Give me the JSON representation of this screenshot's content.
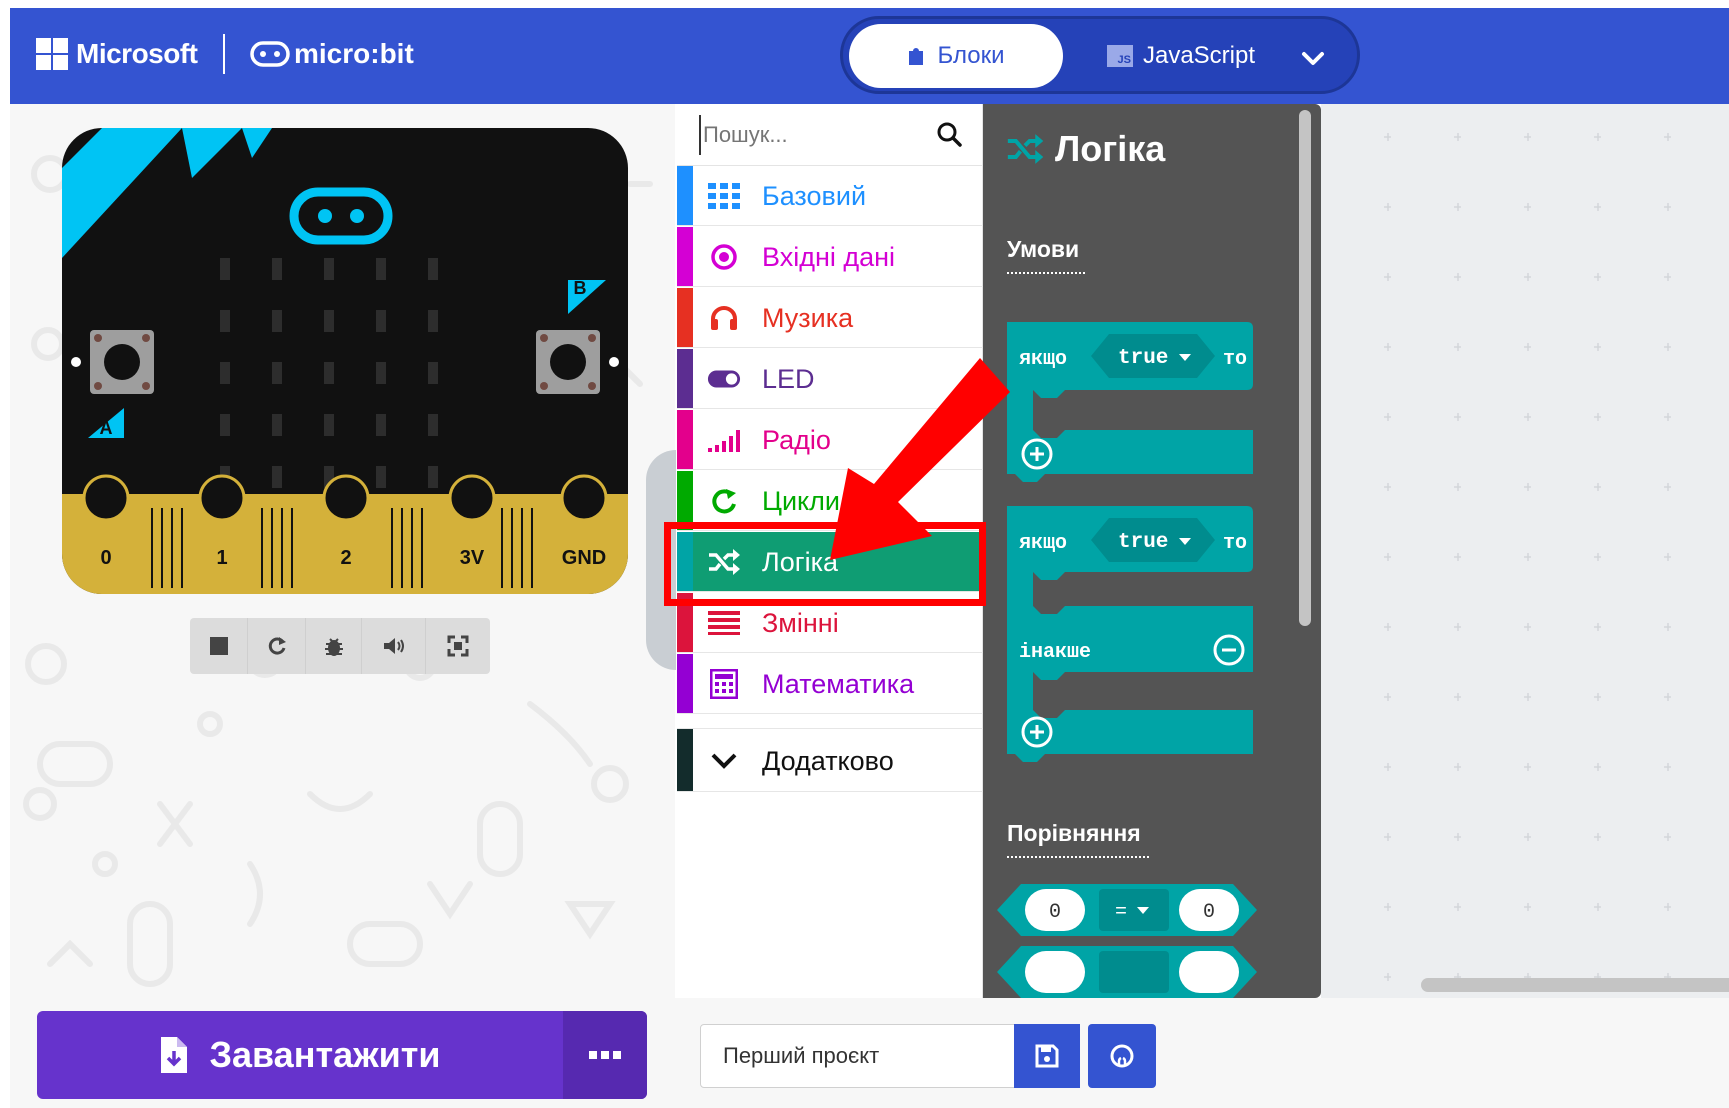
{
  "header": {
    "brand": "Microsoft",
    "product": "micro:bit",
    "tabs": {
      "blocks": "Блоки",
      "javascript": "JavaScript",
      "js_badge": "JS"
    },
    "colors": {
      "bar": "#3454d1"
    }
  },
  "simulator": {
    "pins": [
      "0",
      "1",
      "2",
      "3V",
      "GND"
    ],
    "button_a": "A",
    "button_b": "B",
    "controls": [
      "stop-icon",
      "restart-icon",
      "debug-icon",
      "sound-icon",
      "fullscreen-icon"
    ],
    "colors": {
      "board": "#111111",
      "accent": "#00c4f4",
      "pins": "#d4b13a"
    }
  },
  "toolbox": {
    "search_placeholder": "Пошук...",
    "categories": [
      {
        "label": "Базовий",
        "color": "#1e90ff",
        "icon": "grid-icon"
      },
      {
        "label": "Вхідні дані",
        "color": "#d400d4",
        "icon": "target-icon"
      },
      {
        "label": "Музика",
        "color": "#e63022",
        "icon": "headphones-icon"
      },
      {
        "label": "LED",
        "color": "#5c2d91",
        "icon": "toggle-icon"
      },
      {
        "label": "Радіо",
        "color": "#e3008c",
        "icon": "signal-icon"
      },
      {
        "label": "Цикли",
        "color": "#00aa00",
        "icon": "refresh-icon"
      },
      {
        "label": "Логіка",
        "color": "#00a4a6",
        "icon": "shuffle-icon",
        "selected": true
      },
      {
        "label": "Змінні",
        "color": "#dc143c",
        "icon": "lines-icon"
      },
      {
        "label": "Математика",
        "color": "#9400d3",
        "icon": "calculator-icon"
      }
    ],
    "advanced": {
      "label": "Додатково",
      "color": "#132c2c"
    }
  },
  "flyout": {
    "title": "Логіка",
    "sections": {
      "conditions": "Умови",
      "comparison": "Порівняння"
    },
    "blocks": {
      "if_label": "якщо",
      "then_label": "то",
      "true_value": "true",
      "else_label": "інакше",
      "compare_left": "0",
      "compare_op": "=",
      "compare_right": "0"
    },
    "colors": {
      "block": "#00a4a6",
      "block_dark": "#008c8e",
      "background": "#545454"
    }
  },
  "bottom": {
    "download_label": "Завантажити",
    "project_name": "Перший проєкт",
    "colors": {
      "download": "#6633cc"
    }
  },
  "annotation": {
    "color": "#ff0000"
  }
}
